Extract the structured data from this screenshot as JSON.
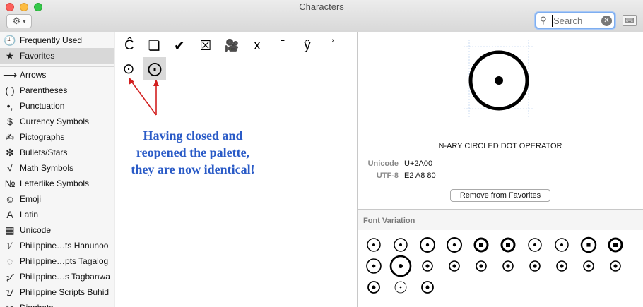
{
  "window": {
    "title": "Characters",
    "search_placeholder": "Search",
    "gear_icon": "gear-icon",
    "chevron_glyph": "▾",
    "clear_glyph": "✕",
    "keyboard_glyph": "⌨"
  },
  "sidebar": {
    "items": [
      {
        "label": "Frequently Used",
        "icon": "clock-icon",
        "glyph": "🕘"
      },
      {
        "label": "Favorites",
        "icon": "star-icon",
        "glyph": "★"
      },
      {
        "label": "Arrows",
        "icon": "arrow-icon",
        "glyph": "⟶"
      },
      {
        "label": "Parentheses",
        "icon": "parentheses-icon",
        "glyph": "( )"
      },
      {
        "label": "Punctuation",
        "icon": "punctuation-icon",
        "glyph": "•,"
      },
      {
        "label": "Currency Symbols",
        "icon": "dollar-icon",
        "glyph": "$"
      },
      {
        "label": "Pictographs",
        "icon": "pictograph-icon",
        "glyph": "✍"
      },
      {
        "label": "Bullets/Stars",
        "icon": "asterisk-icon",
        "glyph": "✻"
      },
      {
        "label": "Math Symbols",
        "icon": "sqrt-icon",
        "glyph": "√"
      },
      {
        "label": "Letterlike Symbols",
        "icon": "numero-icon",
        "glyph": "№"
      },
      {
        "label": "Emoji",
        "icon": "smiley-icon",
        "glyph": "☺"
      },
      {
        "label": "Latin",
        "icon": "latin-a-icon",
        "glyph": "A"
      },
      {
        "label": "Unicode",
        "icon": "unicode-grid-icon",
        "glyph": "▦"
      },
      {
        "label": "Philippine…ts Hanunoo",
        "icon": "hanunoo-icon",
        "glyph": "ᜠ"
      },
      {
        "label": "Philippine…pts Tagalog",
        "icon": "tagalog-icon",
        "glyph": "ᜀ"
      },
      {
        "label": "Philippine…s Tagbanwa",
        "icon": "tagbanwa-icon",
        "glyph": "ᝠ"
      },
      {
        "label": "Philippine Scripts Buhid",
        "icon": "buhid-icon",
        "glyph": "ᝀ"
      },
      {
        "label": "Dingbats",
        "icon": "dingbat-icon",
        "glyph": "✂"
      }
    ]
  },
  "favorites": {
    "chars": [
      "Ĉ",
      "❏",
      "✔",
      "☒",
      "🎥",
      "x",
      "ˉ",
      "ŷ",
      "ʾ",
      "⊙",
      "⨀"
    ]
  },
  "annotation": {
    "lines": [
      "Having closed and",
      "reopened the palette,",
      "they are now identical!"
    ]
  },
  "detail": {
    "glyph": "⨀",
    "name": "N-ARY CIRCLED DOT OPERATOR",
    "unicode_label": "Unicode",
    "unicode_value": "U+2A00",
    "utf8_label": "UTF-8",
    "utf8_value": "E2 A8 80",
    "remove_button": "Remove from Favorites"
  },
  "font_variation": {
    "title": "Font Variation",
    "count": 23
  }
}
